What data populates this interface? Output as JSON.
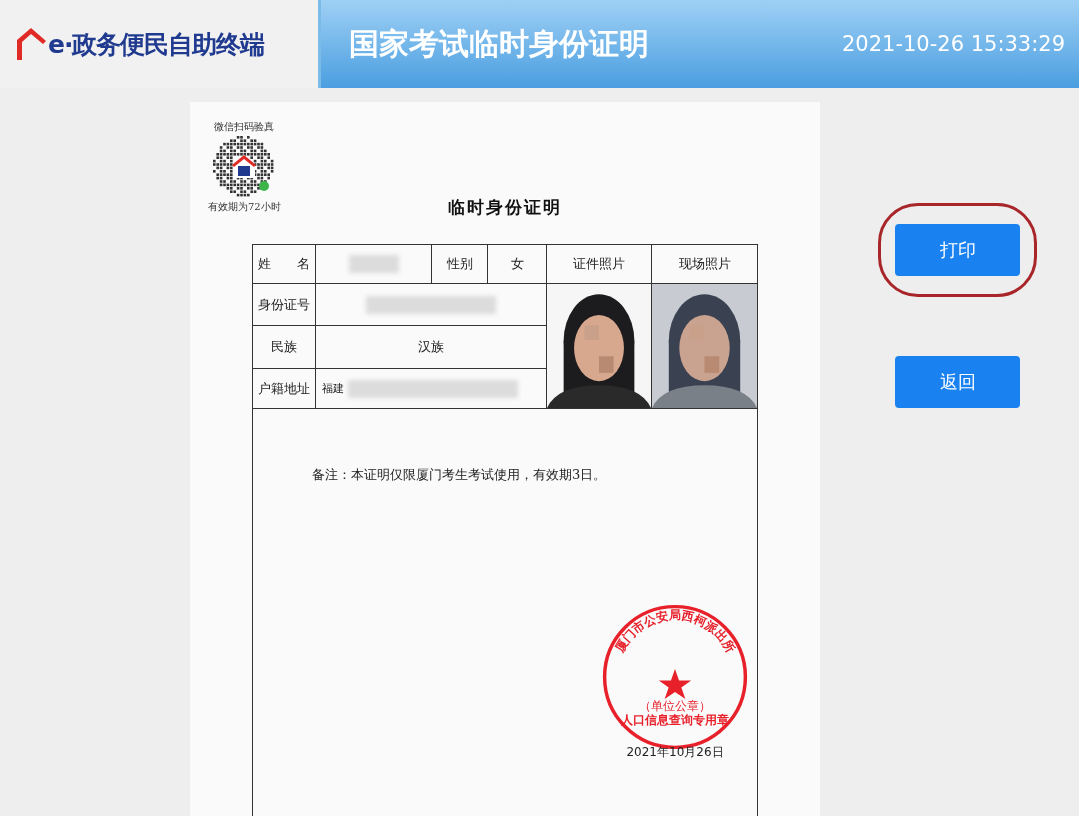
{
  "header": {
    "logo_text": "e·政务便民自助终端",
    "title": "国家考试临时身份证明",
    "datetime": "2021-10-26 15:33:29"
  },
  "document": {
    "qr_caption_top": "微信扫码验真",
    "qr_caption_bottom": "有效期为72小时",
    "title": "临时身份证明",
    "table": {
      "name_label": "姓　　名",
      "gender_label": "性别",
      "gender_value": "女",
      "id_photo_label": "证件照片",
      "live_photo_label": "现场照片",
      "id_label": "身份证号",
      "ethnicity_label": "民族",
      "ethnicity_value": "汉族",
      "address_label": "户籍地址",
      "address_value": "福建"
    },
    "note": "备注：本证明仅限厦门考生考试使用，有效期3日。",
    "stamp": {
      "ring_text": "厦门市公安局西柯派出所",
      "center_text": "（单位公章）",
      "bottom_text": "人口信息查询专用章"
    },
    "date": "2021年10月26日"
  },
  "buttons": [
    {
      "label": "打印",
      "highlighted": true
    },
    {
      "label": "返回",
      "highlighted": false
    }
  ]
}
